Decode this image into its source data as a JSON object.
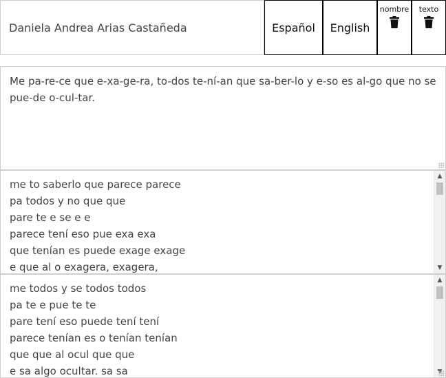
{
  "header": {
    "name_value": "Daniela Andrea Arias Castañeda",
    "btn_spanish": "Español",
    "btn_english": "English",
    "btn_delete_name": "nombre",
    "btn_delete_text": "texto",
    "trash_icon": "trash-icon"
  },
  "main_text": "Me pa-re-ce que e-xa-ge-ra, to-dos te-ní-an que sa-ber-lo y e-so es al-go que no se pue-de o-cul-tar.",
  "list1": {
    "lines": [
      "me to saberlo que parece parece",
      "pa todos y no que que",
      "pare te e se e e",
      "parece tení eso pue exa exa",
      "que tenían es puede exage exage",
      "e que al o exagera, exagera,"
    ],
    "scroll_up_glyph": "▲",
    "scroll_down_glyph": "▼"
  },
  "list2": {
    "lines": [
      "me todos y se todos todos",
      "pa te e pue te te",
      "pare tení eso puede tení tení",
      "parece tenían es o tenían tenían",
      "que que al ocul que que",
      "e sa algo ocultar. sa sa"
    ],
    "scroll_up_glyph": "▲",
    "scroll_down_glyph": "▼"
  }
}
